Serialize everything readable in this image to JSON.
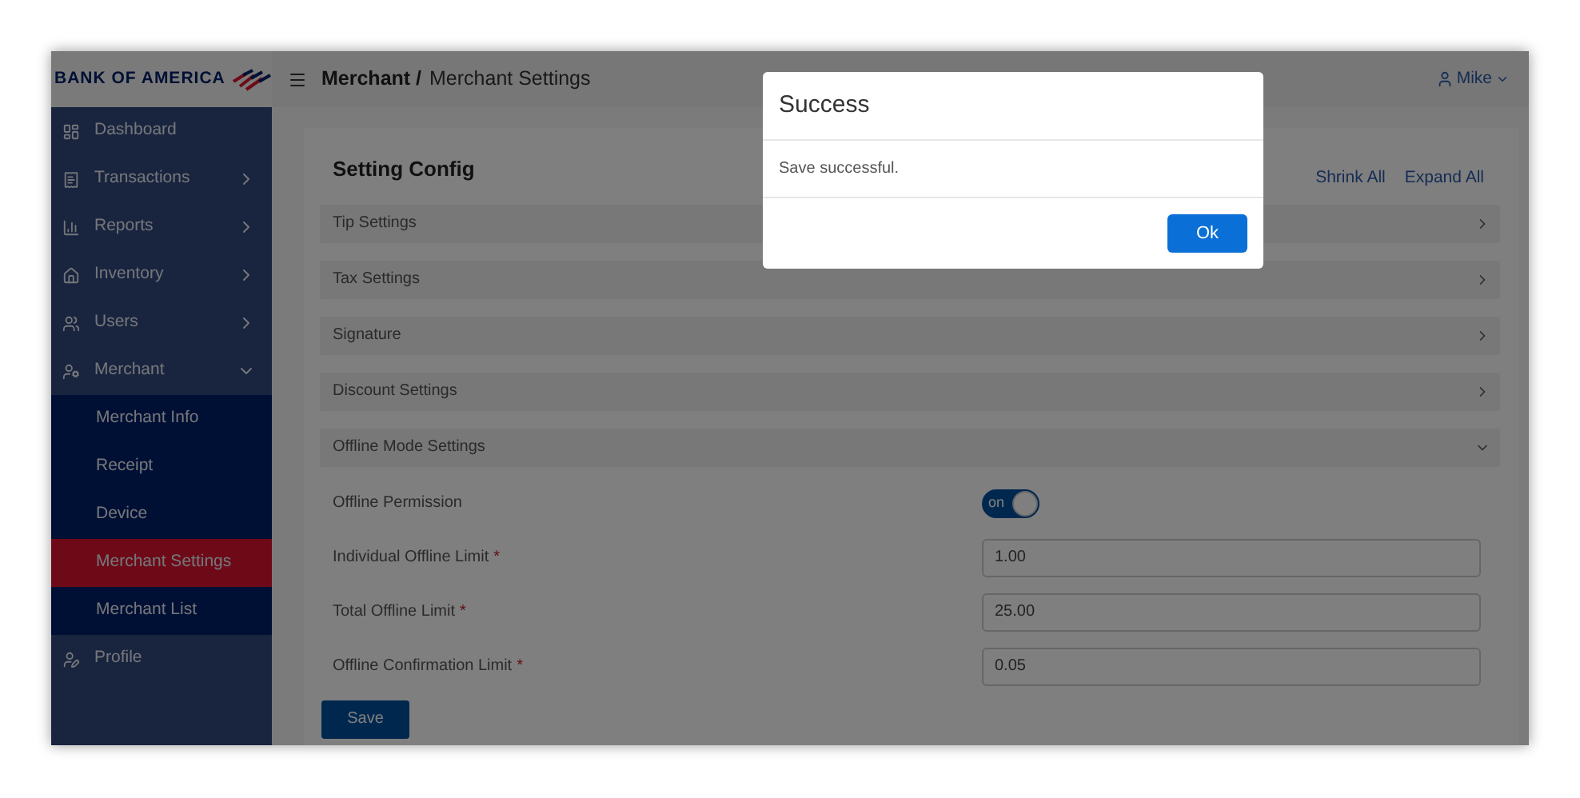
{
  "brand": {
    "name": "BANK OF AMERICA"
  },
  "sidebar": {
    "items": [
      {
        "kind": "link",
        "label": "Dashboard"
      },
      {
        "kind": "group",
        "label": "Transactions",
        "expanded": false
      },
      {
        "kind": "group",
        "label": "Reports",
        "expanded": false
      },
      {
        "kind": "group",
        "label": "Inventory",
        "expanded": false
      },
      {
        "kind": "group",
        "label": "Users",
        "expanded": false
      },
      {
        "kind": "group",
        "label": "Merchant",
        "expanded": true,
        "children": [
          {
            "label": "Merchant Info",
            "selected": false
          },
          {
            "label": "Receipt",
            "selected": false
          },
          {
            "label": "Device",
            "selected": false
          },
          {
            "label": "Merchant Settings",
            "selected": true
          },
          {
            "label": "Merchant List",
            "selected": false
          }
        ]
      },
      {
        "kind": "link",
        "label": "Profile"
      }
    ]
  },
  "header": {
    "breadcrumb": [
      "Merchant /",
      "Merchant Settings"
    ],
    "user": "Mike"
  },
  "card": {
    "title": "Setting Config",
    "actions": [
      "Shrink All",
      "Expand All"
    ],
    "sections": [
      {
        "label": "Tip Settings",
        "expanded": false
      },
      {
        "label": "Tax Settings",
        "expanded": false
      },
      {
        "label": "Signature",
        "expanded": false
      },
      {
        "label": "Discount Settings",
        "expanded": false
      },
      {
        "label": "Offline Mode Settings",
        "expanded": true
      }
    ],
    "fields": [
      {
        "kind": "toggle",
        "label": "Offline Permission",
        "on": true,
        "text": "on"
      },
      {
        "kind": "input",
        "label": "Individual Offline Limit",
        "required_mark": "*",
        "value": "1.00"
      },
      {
        "kind": "input",
        "label": "Total Offline Limit",
        "required_mark": "*",
        "value": "25.00"
      },
      {
        "kind": "input",
        "label": "Offline Confirmation Limit",
        "required_mark": "*",
        "value": "0.05"
      }
    ],
    "save": "Save"
  },
  "dialog": {
    "title": "Success",
    "message": "Save successful.",
    "button": "Ok"
  }
}
